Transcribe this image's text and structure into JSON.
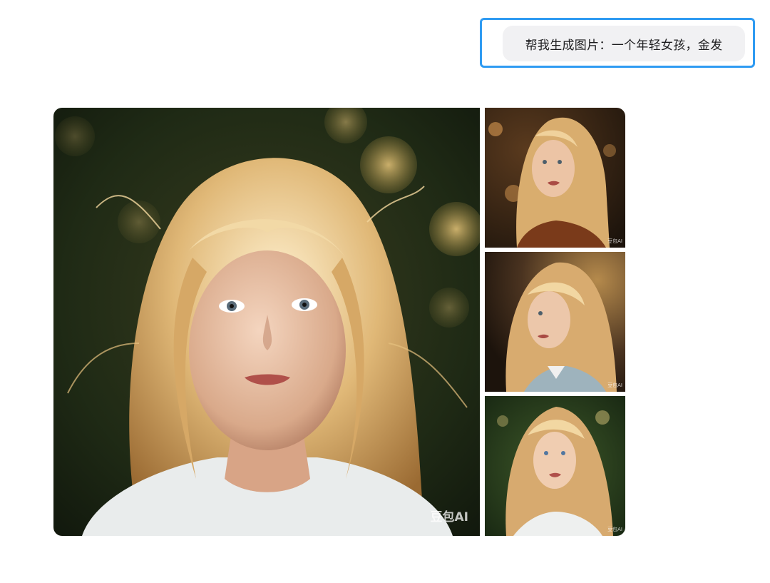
{
  "prompt": {
    "text": "帮我生成图片：一个年轻女孩，金发"
  },
  "images": [
    {
      "id": "main",
      "watermark": "豆包AI"
    },
    {
      "id": "thumb-1",
      "watermark": "豆包AI"
    },
    {
      "id": "thumb-2",
      "watermark": "豆包AI"
    },
    {
      "id": "thumb-3",
      "watermark": "豆包AI"
    }
  ],
  "colors": {
    "focus_border": "#2f9bf2",
    "bubble_bg": "#f1f1f3"
  }
}
